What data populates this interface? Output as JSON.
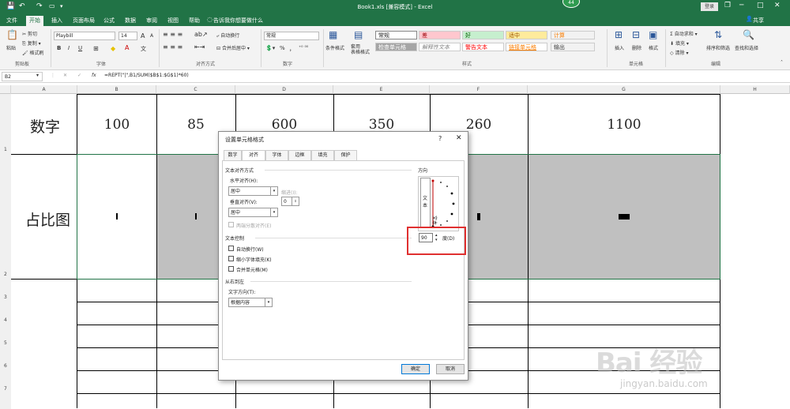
{
  "titlebar": {
    "quick_access_more": "▾",
    "title": "Book1.xls [兼容模式] - Excel",
    "login": "登录",
    "badge": "44",
    "restore": "❐",
    "minimize": "─",
    "maximize": "□",
    "close": "✕"
  },
  "tabs": [
    "文件",
    "开始",
    "插入",
    "页面布局",
    "公式",
    "数据",
    "审阅",
    "视图",
    "帮助"
  ],
  "tell_me": "告诉我你想要做什么",
  "share": "共享",
  "ribbon": {
    "clipboard": {
      "paste": "粘贴",
      "cut": "剪切",
      "copy": "复制 ▾",
      "format_painter": "格式刷",
      "label": "剪贴板"
    },
    "font": {
      "name": "Playbill",
      "size": "14",
      "grow": "A",
      "shrink": "A",
      "bold": "B",
      "italic": "I",
      "underline": "U",
      "label": "字体",
      "phonetic": "文"
    },
    "alignment": {
      "wrap": "自动换行",
      "merge": "合并后居中 ▾",
      "label": "对齐方式"
    },
    "number": {
      "format": "常规",
      "label": "数字",
      "percent": "%",
      "comma": "，"
    },
    "styles": {
      "conditional": "条件格式",
      "table": "套用\n表格格式",
      "normal": "常规",
      "bad": "差",
      "good": "好",
      "neutral": "适中",
      "calc": "计算",
      "check": "检查单元格",
      "explain": "解释性文本",
      "warn": "警告文本",
      "link": "链接单元格",
      "output": "输出",
      "label": "样式"
    },
    "cells": {
      "insert": "插入",
      "delete": "删除",
      "format": "格式",
      "label": "单元格"
    },
    "editing": {
      "autosum": "自动求和 ▾",
      "fill": "填充 ▾",
      "clear": "清除 ▾",
      "sort": "排序和筛选",
      "find": "查找和选择",
      "label": "编辑"
    }
  },
  "formulabar": {
    "namebox": "B2",
    "cancel": "✕",
    "enter": "✓",
    "fx": "fx",
    "formula": "=REPT(\"|\",B1/SUM($B$1:$G$1)*60)"
  },
  "columns": [
    "A",
    "B",
    "C",
    "D",
    "E",
    "F",
    "G",
    "H"
  ],
  "rows": [
    "1",
    "2",
    "3",
    "4",
    "5",
    "6",
    "7"
  ],
  "cells": {
    "a1": "数字",
    "a2": "占比图",
    "values": [
      "100",
      "85",
      "600",
      "350",
      "260",
      "1100"
    ]
  },
  "dialog": {
    "title": "设置单元格格式",
    "help": "?",
    "close": "✕",
    "tabs": [
      "数字",
      "对齐",
      "字体",
      "边框",
      "填充",
      "保护"
    ],
    "align_section": "文本对齐方式",
    "h_align_label": "水平对齐(H):",
    "h_align_value": "居中",
    "indent_label": "缩进(I):",
    "indent_value": "0",
    "v_align_label": "垂直对齐(V):",
    "v_align_value": "居中",
    "distributed": "两端分散对齐(E)",
    "control_section": "文本控制",
    "wrap": "自动换行(W)",
    "shrink": "缩小字体填充(K)",
    "merge": "合并单元格(M)",
    "rtl_section": "从右到左",
    "direction_label": "文字方向(T):",
    "direction_value": "根据内容",
    "orientation_label": "方向",
    "vertical_text": "文本",
    "dial_text": "文本",
    "degrees_value": "90",
    "degrees_label": "度(D)",
    "ok": "确定",
    "cancel": "取消"
  },
  "watermark": {
    "text": "Bai 经验",
    "url": "jingyan.baidu.com"
  }
}
